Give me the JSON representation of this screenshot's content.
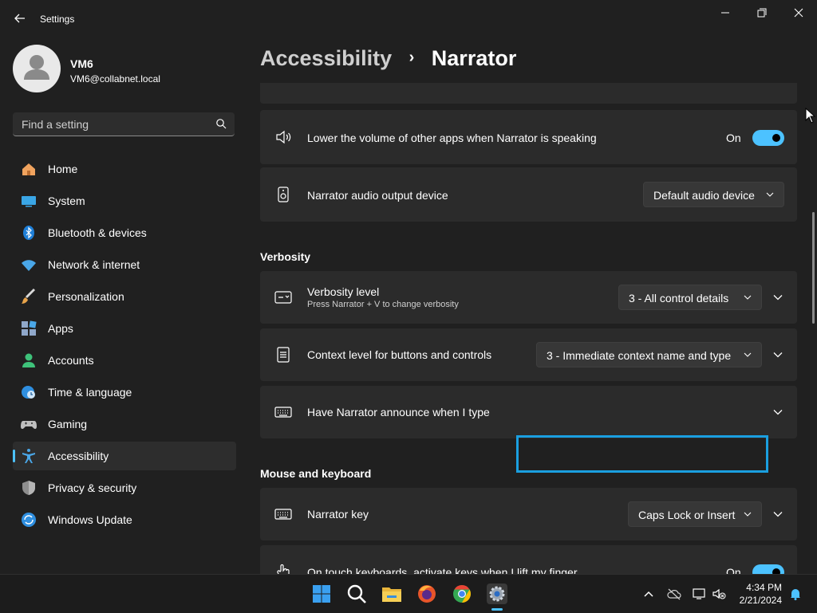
{
  "window": {
    "title": "Settings"
  },
  "user": {
    "name": "VM6",
    "email": "VM6@collabnet.local"
  },
  "search": {
    "placeholder": "Find a setting"
  },
  "nav": [
    {
      "label": "Home",
      "icon": "home-icon"
    },
    {
      "label": "System",
      "icon": "system-icon"
    },
    {
      "label": "Bluetooth & devices",
      "icon": "bluetooth-icon"
    },
    {
      "label": "Network & internet",
      "icon": "wifi-icon"
    },
    {
      "label": "Personalization",
      "icon": "brush-icon"
    },
    {
      "label": "Apps",
      "icon": "apps-icon"
    },
    {
      "label": "Accounts",
      "icon": "accounts-icon"
    },
    {
      "label": "Time & language",
      "icon": "clock-globe-icon"
    },
    {
      "label": "Gaming",
      "icon": "gamepad-icon"
    },
    {
      "label": "Accessibility",
      "icon": "accessibility-icon",
      "active": true
    },
    {
      "label": "Privacy & security",
      "icon": "shield-icon"
    },
    {
      "label": "Windows Update",
      "icon": "update-icon"
    }
  ],
  "breadcrumb": {
    "parent": "Accessibility",
    "current": "Narrator"
  },
  "settings": {
    "lower_volume": {
      "label": "Lower the volume of other apps when Narrator is speaking",
      "state": "On"
    },
    "audio_output": {
      "label": "Narrator audio output device",
      "value": "Default audio device"
    },
    "verbosity_header": "Verbosity",
    "verbosity_level": {
      "label": "Verbosity level",
      "sub": "Press Narrator + V to change verbosity",
      "value": "3 - All control details"
    },
    "context_level": {
      "label": "Context level for buttons and controls",
      "value": "3 - Immediate context name and type"
    },
    "announce_typing": {
      "label": "Have Narrator announce when I type"
    },
    "mouse_keyboard_header": "Mouse and keyboard",
    "narrator_key": {
      "label": "Narrator key",
      "value": "Caps Lock or Insert"
    },
    "touch_keyboard": {
      "label": "On touch keyboards, activate keys when I lift my finger",
      "state": "On"
    }
  },
  "taskbar": {
    "apps": [
      "start-icon",
      "search-icon",
      "file-explorer-icon",
      "firefox-icon",
      "chrome-icon",
      "settings-icon"
    ],
    "time": "4:34 PM",
    "date": "2/21/2024"
  },
  "colors": {
    "accent": "#4cc2ff",
    "background": "#202020",
    "card": "#2b2b2b"
  }
}
